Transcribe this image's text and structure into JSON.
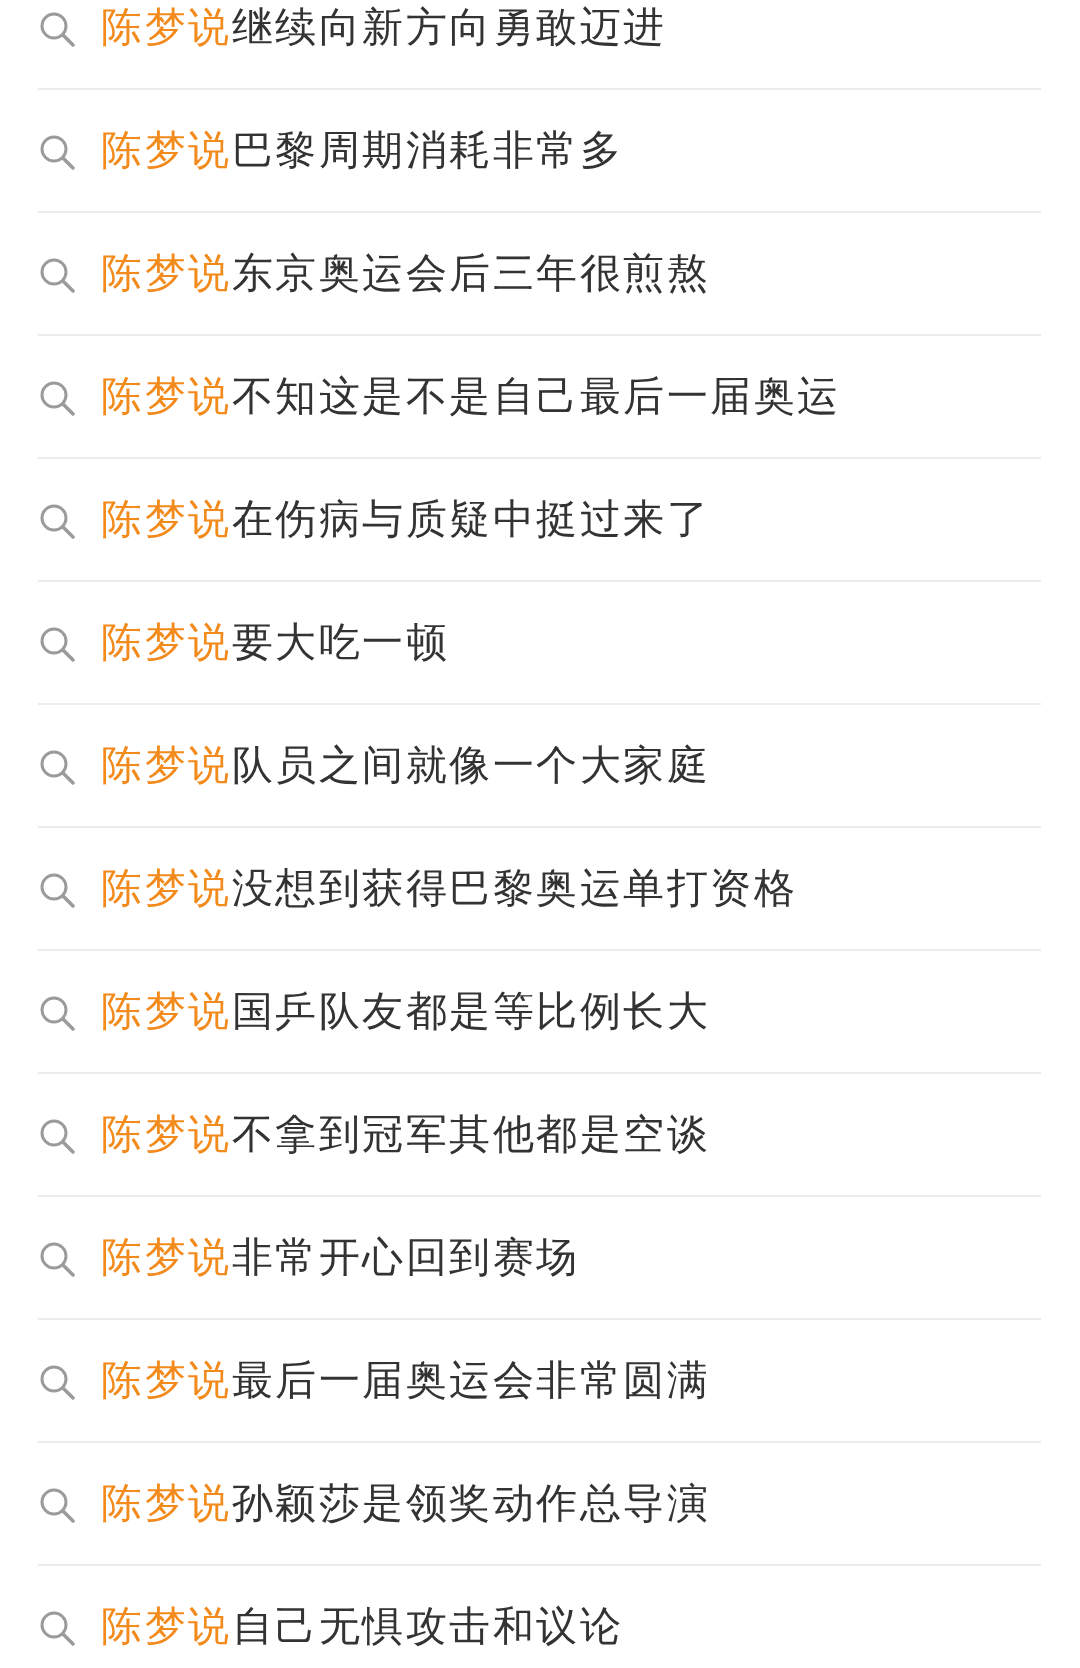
{
  "suggestions": [
    {
      "highlight": "陈梦说",
      "text": "继续向新方向勇敢迈进"
    },
    {
      "highlight": "陈梦说",
      "text": "巴黎周期消耗非常多"
    },
    {
      "highlight": "陈梦说",
      "text": "东京奥运会后三年很煎熬"
    },
    {
      "highlight": "陈梦说",
      "text": "不知这是不是自己最后一届奥运"
    },
    {
      "highlight": "陈梦说",
      "text": "在伤病与质疑中挺过来了"
    },
    {
      "highlight": "陈梦说",
      "text": "要大吃一顿"
    },
    {
      "highlight": "陈梦说",
      "text": "队员之间就像一个大家庭"
    },
    {
      "highlight": "陈梦说",
      "text": "没想到获得巴黎奥运单打资格"
    },
    {
      "highlight": "陈梦说",
      "text": "国乒队友都是等比例长大"
    },
    {
      "highlight": "陈梦说",
      "text": "不拿到冠军其他都是空谈"
    },
    {
      "highlight": "陈梦说",
      "text": "非常开心回到赛场"
    },
    {
      "highlight": "陈梦说",
      "text": "最后一届奥运会非常圆满"
    },
    {
      "highlight": "陈梦说",
      "text": "孙颖莎是领奖动作总导演"
    },
    {
      "highlight": "陈梦说",
      "text": "自己无惧攻击和议论"
    }
  ]
}
